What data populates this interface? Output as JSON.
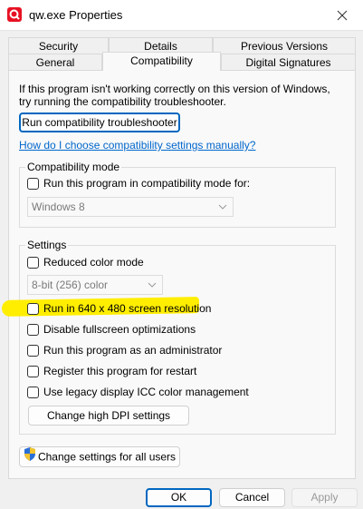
{
  "window": {
    "title": "qw.exe Properties"
  },
  "tabs_row1": [
    {
      "label": "Security"
    },
    {
      "label": "Details"
    },
    {
      "label": "Previous Versions"
    }
  ],
  "tabs_row2": [
    {
      "label": "General"
    },
    {
      "label": "Compatibility",
      "active": true
    },
    {
      "label": "Digital Signatures"
    }
  ],
  "intro": {
    "line1": "If this program isn't working correctly on this version of Windows,",
    "line2": "try running the compatibility troubleshooter."
  },
  "buttons": {
    "troubleshooter": "Run compatibility troubleshooter",
    "dpi": "Change high DPI settings",
    "all_users": "Change settings for all users",
    "ok": "OK",
    "cancel": "Cancel",
    "apply": "Apply"
  },
  "link": "How do I choose compatibility settings manually?",
  "compat_mode": {
    "title": "Compatibility mode",
    "checkbox": "Run this program in compatibility mode for:",
    "select_value": "Windows 8"
  },
  "settings": {
    "title": "Settings",
    "reduced_color": "Reduced color mode",
    "color_select_value": "8-bit (256) color",
    "run_640": "Run in 640 x 480 screen resolution",
    "disable_fullscreen": "Disable fullscreen optimizations",
    "run_admin": "Run this program as an administrator",
    "register_restart": "Register this program for restart",
    "legacy_icc": "Use legacy display ICC color management"
  },
  "colors": {
    "accent": "#0067c0",
    "highlight": "#ffee00",
    "link": "#0066cc",
    "app_icon": "#e81123"
  }
}
